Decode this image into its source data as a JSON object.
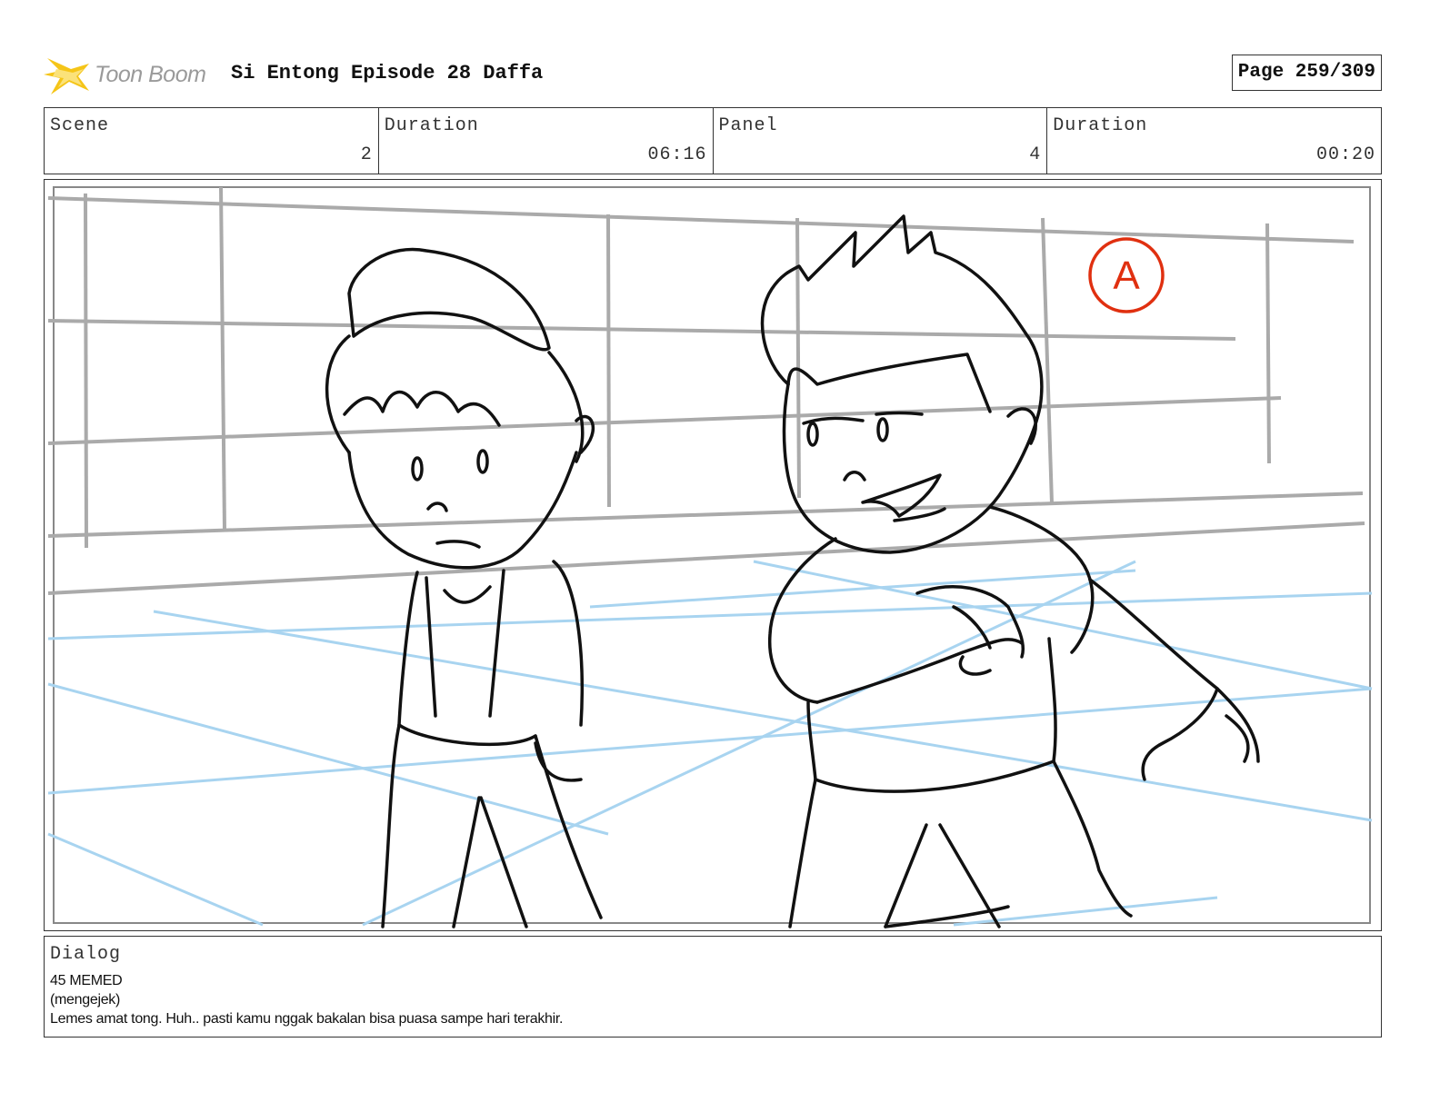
{
  "header": {
    "logo_text": "Toon Boom",
    "title": "Si Entong Episode 28 Daffa",
    "page": "Page 259/309"
  },
  "info": {
    "scene_label": "Scene",
    "scene_value": "2",
    "scene_duration_label": "Duration",
    "scene_duration_value": "06:16",
    "panel_label": "Panel",
    "panel_value": "4",
    "panel_duration_label": "Duration",
    "panel_duration_value": "00:20"
  },
  "panel_art": {
    "mark": "A",
    "colors": {
      "sketch": "#111111",
      "wall": "#aaaaaa",
      "floor": "#a8d4f0",
      "mark": "#e03010"
    }
  },
  "dialog": {
    "label": "Dialog",
    "lines": [
      "45 MEMED",
      "(mengejek)",
      "Lemes amat tong. Huh.. pasti kamu nggak bakalan bisa puasa sampe hari terakhir."
    ]
  },
  "colors": {
    "logo": "#f5c518",
    "border": "#333333"
  }
}
